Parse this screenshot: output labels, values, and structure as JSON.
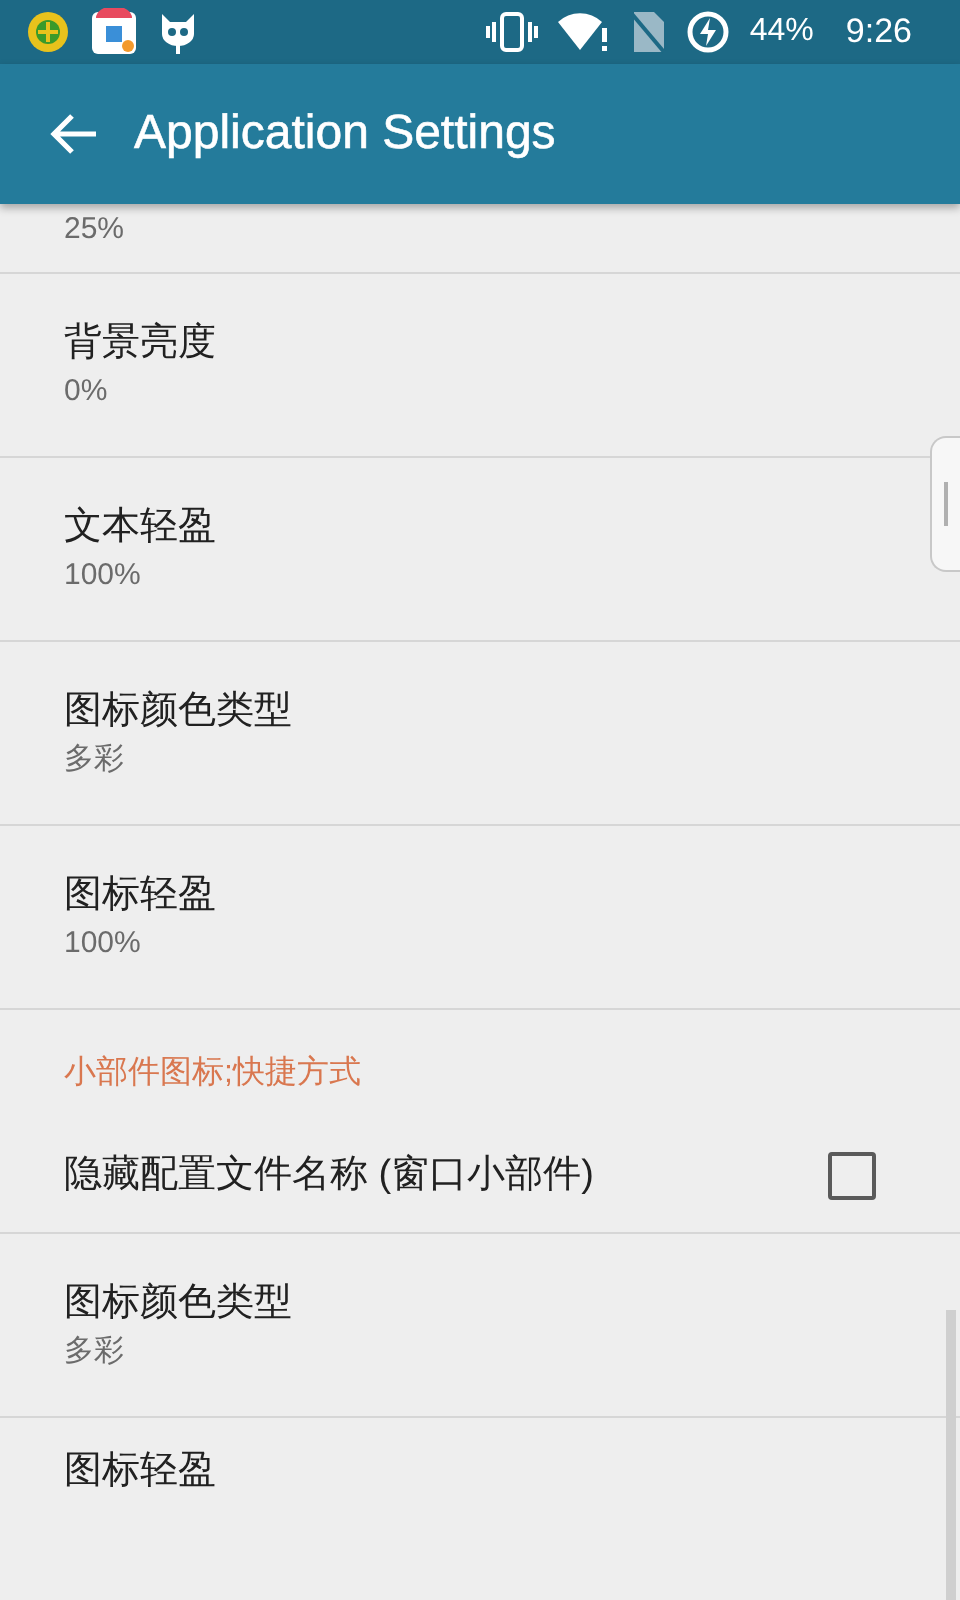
{
  "status_bar": {
    "battery": "44%",
    "time": "9:26"
  },
  "app_bar": {
    "title": "Application Settings"
  },
  "preferences": [
    {
      "kind": "summary",
      "summary": "25%"
    },
    {
      "kind": "text",
      "title": "背景亮度",
      "summary": "0%"
    },
    {
      "kind": "text",
      "title": "文本轻盈",
      "summary": "100%"
    },
    {
      "kind": "text",
      "title": "图标颜色类型",
      "summary": "多彩"
    },
    {
      "kind": "text",
      "title": "图标轻盈",
      "summary": "100%"
    },
    {
      "kind": "category",
      "title": "小部件图标;快捷方式"
    },
    {
      "kind": "checkbox",
      "title": "隐藏配置文件名称 (窗口小部件)",
      "checked": false
    },
    {
      "kind": "text",
      "title": "图标颜色类型",
      "summary": "多彩"
    },
    {
      "kind": "title",
      "title": "图标轻盈"
    }
  ]
}
